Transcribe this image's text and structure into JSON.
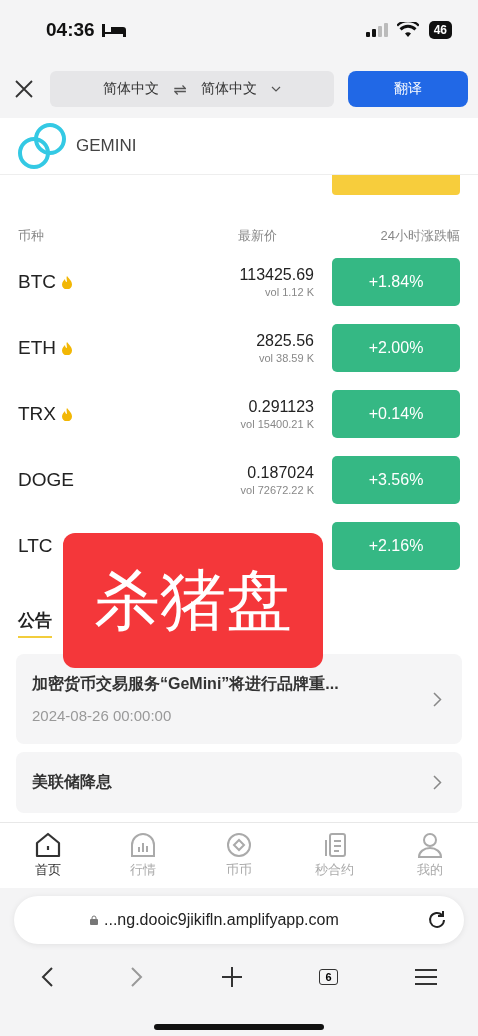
{
  "status_bar": {
    "time": "04:36",
    "battery": "46"
  },
  "translate_bar": {
    "source_language": "简体中文",
    "swap": "⇌",
    "target_language": "简体中文",
    "translate_button": "翻译"
  },
  "header": {
    "brand": "GEMINI"
  },
  "market": {
    "columns": [
      "币种",
      "最新价",
      "24小时涨跌幅"
    ],
    "rows": [
      {
        "symbol": "BTC",
        "hot": true,
        "price": "113425.69",
        "volume": "vol 1.12 K",
        "change": "+1.84%"
      },
      {
        "symbol": "ETH",
        "hot": true,
        "price": "2825.56",
        "volume": "vol 38.59 K",
        "change": "+2.00%"
      },
      {
        "symbol": "TRX",
        "hot": true,
        "price": "0.291123",
        "volume": "vol 15400.21 K",
        "change": "+0.14%"
      },
      {
        "symbol": "DOGE",
        "hot": false,
        "price": "0.187024",
        "volume": "vol 72672.22 K",
        "change": "+3.56%"
      },
      {
        "symbol": "LTC",
        "hot": false,
        "change": "+2.16%"
      }
    ]
  },
  "announcements": {
    "title": "公告",
    "items": [
      {
        "title": "加密货币交易服务“GeMini”将进行品牌重...",
        "date": "2024-08-26 00:00:00"
      },
      {
        "title": "美联储降息"
      }
    ]
  },
  "bottom_nav": [
    {
      "label": "首页",
      "kind": "home",
      "selected": true
    },
    {
      "label": "行情",
      "kind": "chart",
      "selected": false
    },
    {
      "label": "币币",
      "kind": "coin",
      "selected": false
    },
    {
      "label": "秒合约",
      "kind": "doc",
      "selected": false
    },
    {
      "label": "我的",
      "kind": "user",
      "selected": false
    }
  ],
  "browser": {
    "url": "...ng.dooic9jikifln.amplifyapp.com",
    "tab_count": "6"
  },
  "overlay_label": "杀猪盘"
}
